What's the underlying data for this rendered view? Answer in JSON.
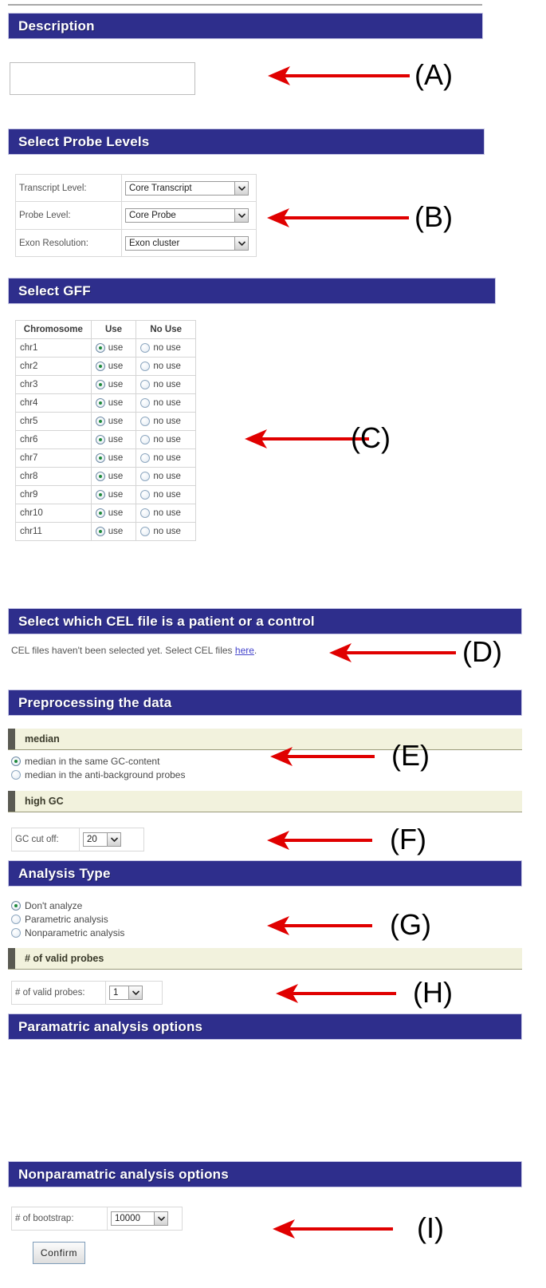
{
  "accent": {
    "header_blue": "#2e2e8c",
    "subheader_cream": "#f2f2dd",
    "arrow_red": "#e00000",
    "link_blue": "#4444cc",
    "radio_green": "#1f8a3c"
  },
  "sections": {
    "description": {
      "title": "Description",
      "input_value": "",
      "input_placeholder": ""
    },
    "probe_levels": {
      "title": "Select Probe Levels",
      "rows": [
        {
          "label": "Transcript Level:",
          "value": "Core Transcript"
        },
        {
          "label": "Probe Level:",
          "value": "Core Probe"
        },
        {
          "label": "Exon Resolution:",
          "value": "Exon cluster"
        }
      ]
    },
    "gff": {
      "title": "Select GFF",
      "columns": [
        "Chromosome",
        "Use",
        "No Use"
      ],
      "use_label": "use",
      "no_use_label": "no use",
      "rows": [
        {
          "chromosome": "chr1",
          "selected": "use"
        },
        {
          "chromosome": "chr2",
          "selected": "use"
        },
        {
          "chromosome": "chr3",
          "selected": "use"
        },
        {
          "chromosome": "chr4",
          "selected": "use"
        },
        {
          "chromosome": "chr5",
          "selected": "use"
        },
        {
          "chromosome": "chr6",
          "selected": "use"
        },
        {
          "chromosome": "chr7",
          "selected": "use"
        },
        {
          "chromosome": "chr8",
          "selected": "use"
        },
        {
          "chromosome": "chr9",
          "selected": "use"
        },
        {
          "chromosome": "chr10",
          "selected": "use"
        },
        {
          "chromosome": "chr11",
          "selected": "use"
        }
      ]
    },
    "cel": {
      "title": "Select which CEL file is a patient or a control",
      "message_before": "CEL files haven't been selected yet. Select CEL files ",
      "link_text": "here",
      "message_after": "."
    },
    "preprocessing": {
      "title": "Preprocessing the data",
      "median": {
        "subtitle": "median",
        "options": [
          {
            "label": "median in the same GC-content",
            "selected": true
          },
          {
            "label": "median in the anti-background probes",
            "selected": false
          }
        ]
      },
      "high_gc": {
        "subtitle": "high GC",
        "field_label": "GC cut off:",
        "field_value": "20"
      }
    },
    "analysis_type": {
      "title": "Analysis Type",
      "options": [
        {
          "label": "Don't analyze",
          "selected": true
        },
        {
          "label": "Parametric analysis",
          "selected": false
        },
        {
          "label": "Nonparametric analysis",
          "selected": false
        }
      ],
      "valid_probes": {
        "subtitle": "# of valid probes",
        "field_label": "# of valid probes:",
        "field_value": "1"
      }
    },
    "parametric_options": {
      "title": "Paramatric analysis options"
    },
    "nonparametric_options": {
      "title": "Nonparamatric analysis options",
      "field_label": "# of bootstrap:",
      "field_value": "10000",
      "confirm_label": "Confirm"
    }
  },
  "annotations": [
    {
      "letter": "(A)"
    },
    {
      "letter": "(B)"
    },
    {
      "letter": "(C)"
    },
    {
      "letter": "(D)"
    },
    {
      "letter": "(E)"
    },
    {
      "letter": "(F)"
    },
    {
      "letter": "(G)"
    },
    {
      "letter": "(H)"
    },
    {
      "letter": "(I)"
    }
  ]
}
